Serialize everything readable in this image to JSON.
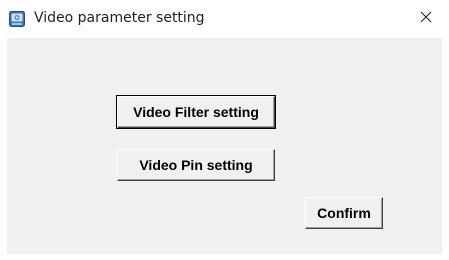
{
  "window": {
    "title": "Video parameter setting",
    "app_icon": "video-app-icon",
    "close_icon": "close-icon"
  },
  "buttons": {
    "video_filter_setting": "Video Filter setting",
    "video_pin_setting": "Video Pin setting",
    "confirm": "Confirm"
  },
  "colors": {
    "dialog_background": "#f0f0f0",
    "titlebar_background": "#ffffff"
  }
}
